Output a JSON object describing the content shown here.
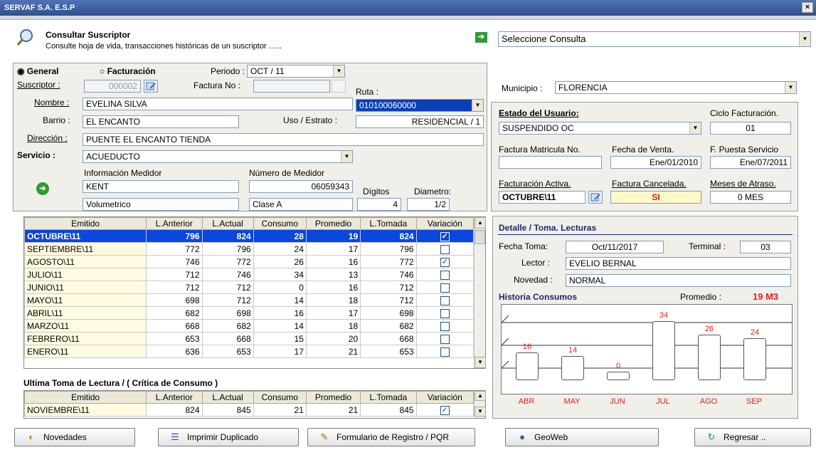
{
  "window": {
    "title": "SERVAF S.A. E.S.P",
    "close": "×"
  },
  "header": {
    "title": "Consultar Suscriptor",
    "subtitle": "Consulte hoja de vida, transacciones históricas de un suscriptor ......",
    "consulta_select": "Seleccione Consulta"
  },
  "form": {
    "radio_general": "General",
    "radio_facturacion": "Facturación",
    "periodo_label": "Periodo :",
    "periodo_value": "OCT / 11",
    "suscriptor_label": "Suscriptor :",
    "suscriptor_value": "000002",
    "factura_label": "Factura No :",
    "factura_value": "",
    "ruta_label": "Ruta :",
    "ruta_value": "010100060000",
    "nombre_label": "Nombre :",
    "nombre_value": "EVELINA SILVA",
    "barrio_label": "Barrio :",
    "barrio_value": "EL ENCANTO",
    "uso_label": "Uso / Estrato :",
    "uso_value": "RESIDENCIAL / 1",
    "direccion_label": "Dirección :",
    "direccion_value": "PUENTE EL ENCANTO TIENDA",
    "servicio_label": "Servicio :",
    "servicio_value": "ACUEDUCTO",
    "info_medidor_label": "Información Medidor",
    "numero_medidor_label": "Número de Medidor",
    "marca_value": "KENT",
    "numero_medidor_value": "06059343",
    "tipo_value": "Volumetrico",
    "clase_value": "Clase A",
    "digitos_label": "Dígitos",
    "digitos_value": "4",
    "diametro_label": "Diametro:",
    "diametro_value": "1/2"
  },
  "right_panel": {
    "municipio_label": "Municipio :",
    "municipio_value": "FLORENCIA",
    "estado_label": "Estado del Usuario:",
    "estado_value": "SUSPENDIDO OC",
    "ciclo_label": "Ciclo Facturación.",
    "ciclo_value": "01",
    "factura_matricula_label": "Factura Matricula No.",
    "factura_matricula_value": "",
    "fecha_venta_label": "Fecha de Venta.",
    "fecha_venta_value": "Ene/01/2010",
    "puesta_servicio_label": "F. Puesta Servicio",
    "puesta_servicio_value": "Ene/07/2011",
    "facturacion_activa_label": "Facturación Activa.",
    "facturacion_activa_value": "OCTUBRE\\11",
    "factura_cancelada_label": "Factura Cancelada.",
    "factura_cancelada_value": "SI",
    "meses_atraso_label": "Meses de Atraso.",
    "meses_atraso_value": "0 MES"
  },
  "grid": {
    "headers": [
      "Emitido",
      "L.Anterior",
      "L.Actual",
      "Consumo",
      "Promedio",
      "L.Tomada",
      "Variación"
    ],
    "rows": [
      [
        "OCTUBRE\\11",
        "796",
        "824",
        "28",
        "19",
        "824",
        true
      ],
      [
        "SEPTIEMBRE\\11",
        "772",
        "796",
        "24",
        "17",
        "796",
        false
      ],
      [
        "AGOSTO\\11",
        "746",
        "772",
        "26",
        "16",
        "772",
        true
      ],
      [
        "JULIO\\11",
        "712",
        "746",
        "34",
        "13",
        "746",
        false
      ],
      [
        "JUNIO\\11",
        "712",
        "712",
        "0",
        "16",
        "712",
        false
      ],
      [
        "MAYO\\11",
        "698",
        "712",
        "14",
        "18",
        "712",
        false
      ],
      [
        "ABRIL\\11",
        "682",
        "698",
        "16",
        "17",
        "698",
        false
      ],
      [
        "MARZO\\11",
        "668",
        "682",
        "14",
        "18",
        "682",
        false
      ],
      [
        "FEBRERO\\11",
        "653",
        "668",
        "15",
        "20",
        "668",
        false
      ],
      [
        "ENERO\\11",
        "636",
        "653",
        "17",
        "21",
        "653",
        false
      ]
    ]
  },
  "ultima": {
    "title": "Ultima Toma de Lectura / ( Crítica de Consumo )",
    "row": [
      "NOVIEMBRE\\11",
      "824",
      "845",
      "21",
      "21",
      "845",
      true
    ]
  },
  "detalle": {
    "title": "Detalle / Toma. Lecturas",
    "fecha_toma_label": "Fecha Toma:",
    "fecha_toma_value": "Oct/11/2017",
    "terminal_label": "Terminal :",
    "terminal_value": "03",
    "lector_label": "Lector :",
    "lector_value": "EVELIO BERNAL",
    "novedad_label": "Novedad :",
    "novedad_value": "NORMAL",
    "historia_label": "Historia Consumos",
    "promedio_label": "Promedio :",
    "promedio_value": "19 M3"
  },
  "chart_data": {
    "type": "bar",
    "categories": [
      "ABR",
      "MAY",
      "JUN",
      "JUL",
      "AGO",
      "SEP"
    ],
    "values": [
      16,
      14,
      0,
      34,
      26,
      24
    ],
    "ylim": [
      0,
      40
    ]
  },
  "buttons": {
    "novedades": "Novedades",
    "imprimir": "Imprimir Duplicado",
    "formulario": "Formulario de Registro / PQR",
    "geoweb": "GeoWeb",
    "regresar": "Regresar .."
  }
}
